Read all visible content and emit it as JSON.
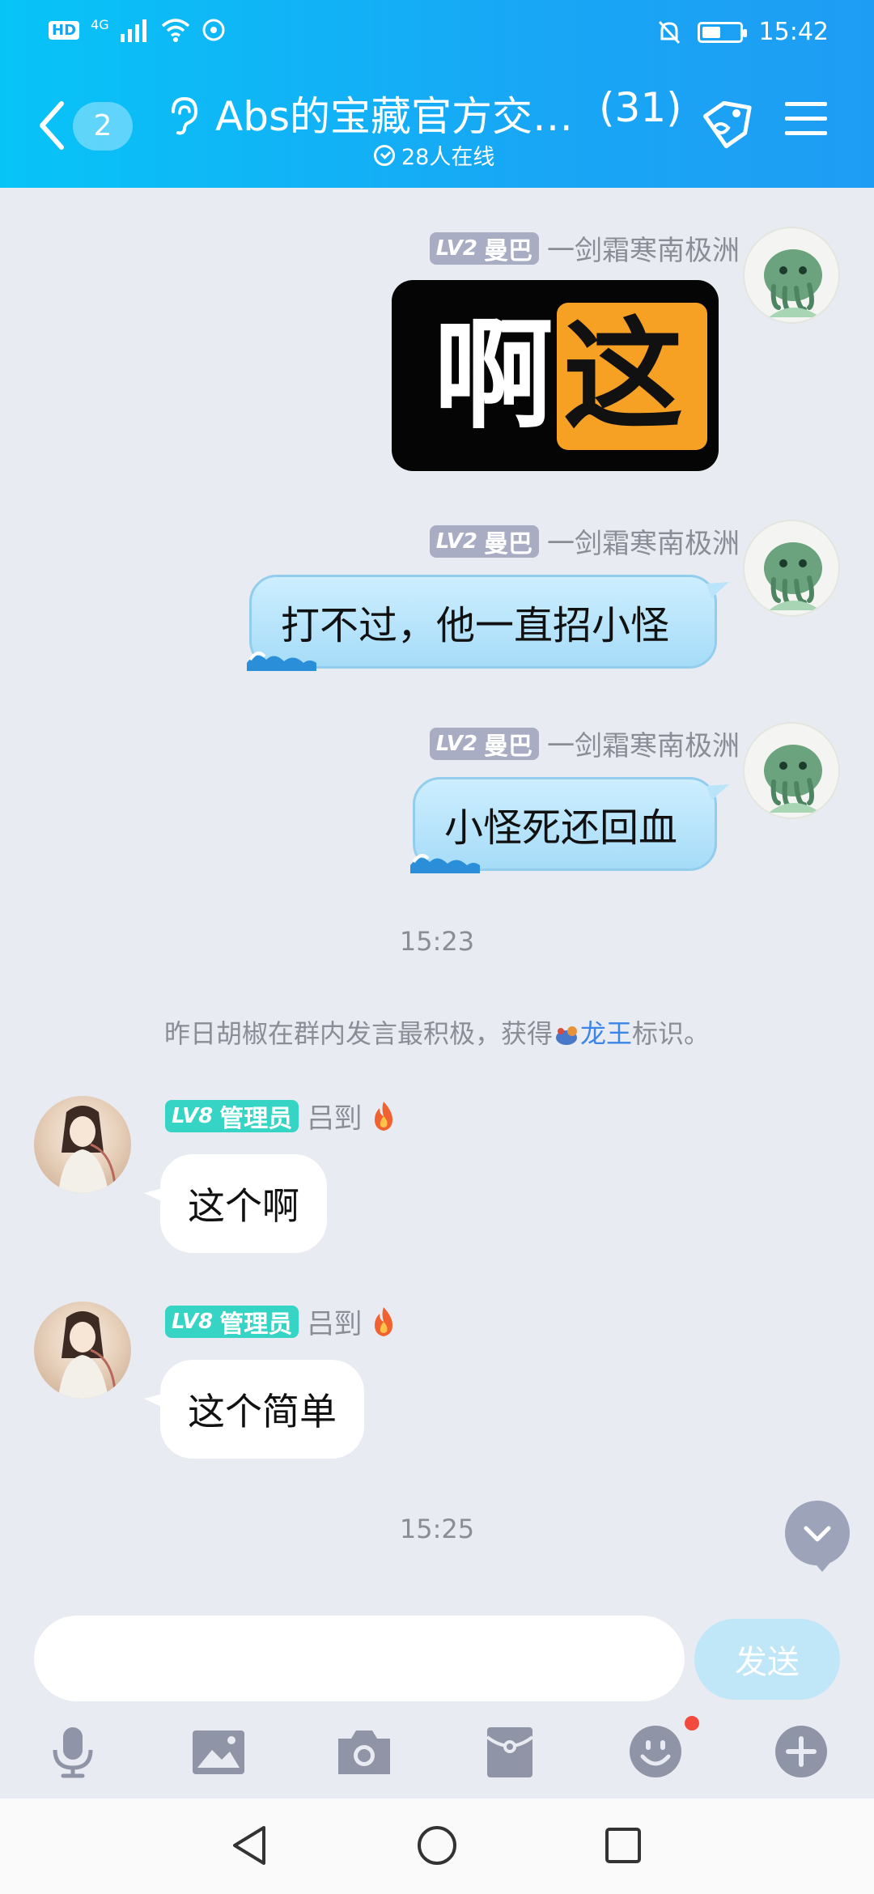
{
  "status_bar": {
    "hd": "HD",
    "network": "4G",
    "time": "15:42",
    "battery_level": 0.5
  },
  "header": {
    "unread_count": "2",
    "title": "Abs的宝藏官方交…",
    "member_count": "(31)",
    "online": "28人在线"
  },
  "messages": [
    {
      "side": "right",
      "level": "LV2",
      "title": "曼巴",
      "name": "一剑霜寒南极洲",
      "sticker": {
        "char1": "啊",
        "char2": "这"
      }
    },
    {
      "side": "right",
      "level": "LV2",
      "title": "曼巴",
      "name": "一剑霜寒南极洲",
      "text": "打不过，他一直招小怪"
    },
    {
      "side": "right",
      "level": "LV2",
      "title": "曼巴",
      "name": "一剑霜寒南极洲",
      "text": "小怪死还回血"
    },
    {
      "side": "left",
      "level": "LV8",
      "title": "管理员",
      "name": "吕剄",
      "text": "这个啊"
    },
    {
      "side": "left",
      "level": "LV8",
      "title": "管理员",
      "name": "吕剄",
      "text": "这个简单"
    }
  ],
  "time_1": "15:23",
  "notice": {
    "before": "昨日胡椒在群内发言最积极，获得",
    "link": "龙王",
    "after": "标识。"
  },
  "time_2": "15:25",
  "input": {
    "value": "",
    "send_label": "发送"
  },
  "toolbar": [
    "microphone-icon",
    "image-icon",
    "camera-icon",
    "red-packet-icon",
    "emoji-icon",
    "plus-icon"
  ],
  "colors": {
    "header_start": "#07c4f7",
    "header_end": "#1e9df4",
    "bubble_right": "#a6dcf8",
    "lv2_badge": "#a9adc3",
    "lv8_badge": "#36d4c4",
    "link": "#3a85e6"
  }
}
